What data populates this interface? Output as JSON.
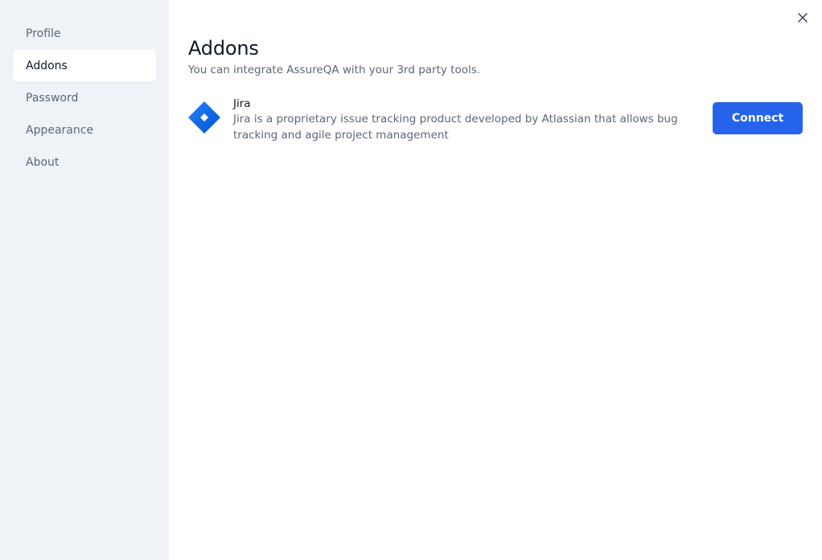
{
  "sidebar": {
    "items": [
      {
        "label": "Profile",
        "active": false
      },
      {
        "label": "Addons",
        "active": true
      },
      {
        "label": "Password",
        "active": false
      },
      {
        "label": "Appearance",
        "active": false
      },
      {
        "label": "About",
        "active": false
      }
    ]
  },
  "main": {
    "title": "Addons",
    "subtitle": "You can integrate AssureQA with your 3rd party tools.",
    "addons": [
      {
        "icon": "jira-logo-icon",
        "name": "Jira",
        "description": "Jira is a proprietary issue tracking product developed by Atlassian that allows bug tracking and agile project management",
        "action_label": "Connect"
      }
    ]
  },
  "window": {
    "close_icon": "close-icon"
  },
  "colors": {
    "sidebar_bg": "#eff3f8",
    "accent": "#2563eb",
    "jira_blue": "#2684ff",
    "text_primary": "#111827",
    "text_secondary": "#5b6779"
  }
}
